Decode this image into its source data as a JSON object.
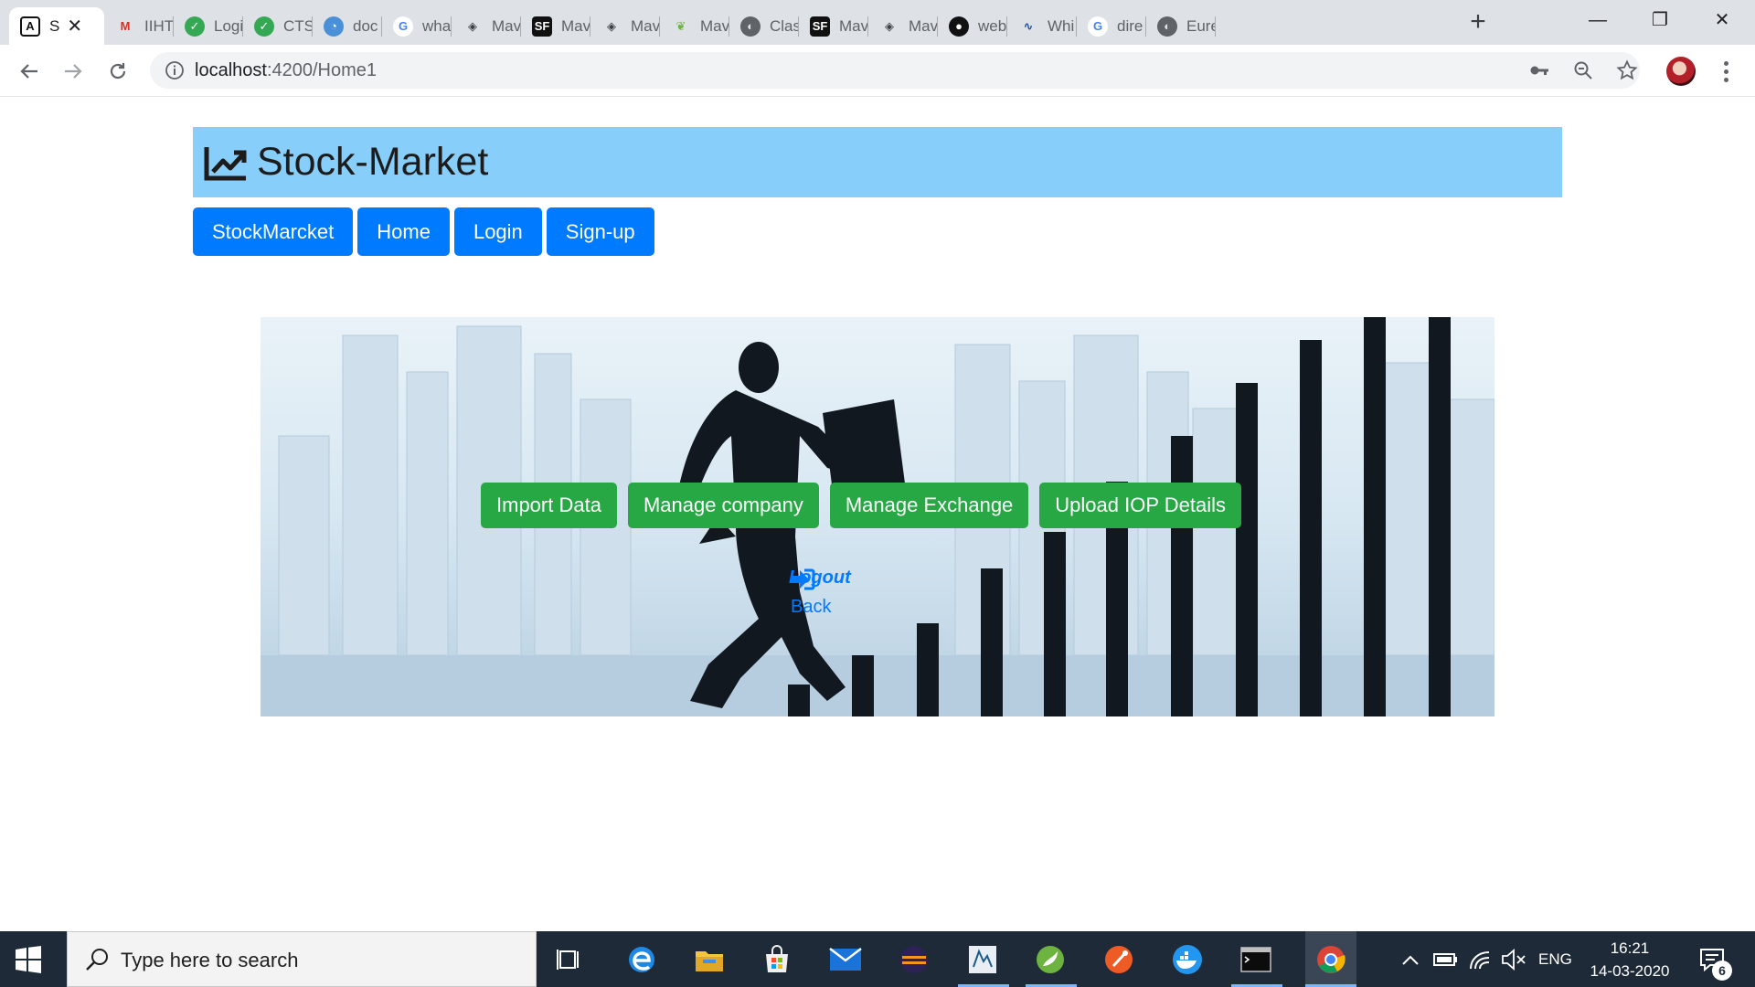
{
  "browser": {
    "tabs": [
      {
        "title": "S",
        "favicon": "angular-icon",
        "active": true
      },
      {
        "title": "IIHT",
        "favicon": "gmail-icon"
      },
      {
        "title": "Logi",
        "favicon": "green-check-icon"
      },
      {
        "title": "CTS",
        "favicon": "green-check-icon"
      },
      {
        "title": "doc",
        "favicon": "blue-circle-icon"
      },
      {
        "title": "wha",
        "favicon": "google-icon"
      },
      {
        "title": "Mav",
        "favicon": "diamond-icon"
      },
      {
        "title": "Mav",
        "favicon": "sf-icon"
      },
      {
        "title": "Mav",
        "favicon": "diamond-icon"
      },
      {
        "title": "Mav",
        "favicon": "leaf-icon"
      },
      {
        "title": "Clas",
        "favicon": "globe-icon"
      },
      {
        "title": "Mav",
        "favicon": "sf-icon"
      },
      {
        "title": "Mav",
        "favicon": "diamond-icon"
      },
      {
        "title": "web",
        "favicon": "github-icon"
      },
      {
        "title": "Whi",
        "favicon": "wave-icon"
      },
      {
        "title": "dire",
        "favicon": "google-icon"
      },
      {
        "title": "Eure",
        "favicon": "globe-icon"
      }
    ],
    "new_tab_label": "+",
    "window_controls": {
      "minimize": "—",
      "restore": "❐",
      "close": "✕"
    },
    "url_host": "localhost",
    "url_rest": ":4200/Home1"
  },
  "app": {
    "title": "Stock-Market",
    "nav": [
      "StockMarcket",
      "Home",
      "Login",
      "Sign-up"
    ],
    "actions": [
      "Import Data",
      "Manage company",
      "Manage Exchange",
      "Upload IOP Details"
    ],
    "logout_label": "Logout",
    "back_label": "Back",
    "colors": {
      "header_bg": "#87cefa",
      "nav_btn": "#007bff",
      "action_btn": "#28a745",
      "link": "#007bff"
    }
  },
  "taskbar": {
    "search_placeholder": "Type here to search",
    "language": "ENG",
    "time": "16:21",
    "date": "14-03-2020",
    "notification_count": "6"
  }
}
